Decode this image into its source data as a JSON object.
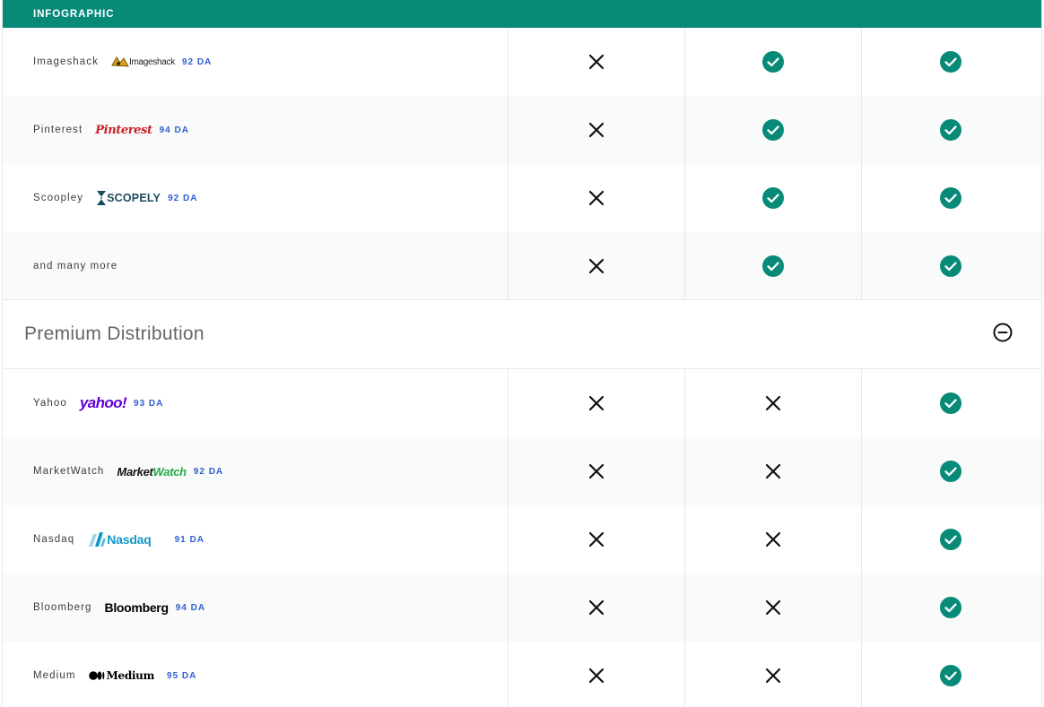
{
  "header": {
    "title": "INFOGRAPHIC"
  },
  "top_rows": [
    {
      "name": "Imageshack",
      "logo": "Imageshack",
      "da": "92 DA",
      "cols": [
        "cross",
        "check",
        "check"
      ]
    },
    {
      "name": "Pinterest",
      "logo": "Pinterest",
      "da": "94 DA",
      "cols": [
        "cross",
        "check",
        "check"
      ]
    },
    {
      "name": "Scoopley",
      "logo": "SCOPELY",
      "da": "92 DA",
      "cols": [
        "cross",
        "check",
        "check"
      ]
    },
    {
      "name": "and many more",
      "cols": [
        "cross",
        "check",
        "check"
      ]
    }
  ],
  "section": {
    "title": "Premium Distribution",
    "toggle_icon": "minus-circle-icon"
  },
  "premium_rows": [
    {
      "name": "Yahoo",
      "logo": "yahoo!",
      "da": "93 DA",
      "cols": [
        "cross",
        "cross",
        "check"
      ]
    },
    {
      "name": "MarketWatch",
      "logo_a": "Market",
      "logo_b": "Watch",
      "da": "92 DA",
      "cols": [
        "cross",
        "cross",
        "check"
      ]
    },
    {
      "name": "Nasdaq",
      "logo": "Nasdaq",
      "da": "91 DA",
      "cols": [
        "cross",
        "cross",
        "check"
      ]
    },
    {
      "name": "Bloomberg",
      "logo": "Bloomberg",
      "da": "94 DA",
      "cols": [
        "cross",
        "cross",
        "check"
      ]
    },
    {
      "name": "Medium",
      "logo": "Medium",
      "da": "95 DA",
      "cols": [
        "cross",
        "cross",
        "check"
      ]
    }
  ],
  "colors": {
    "accent": "#088a78",
    "da_blue": "#2f5fd0",
    "cross": "#111111"
  }
}
